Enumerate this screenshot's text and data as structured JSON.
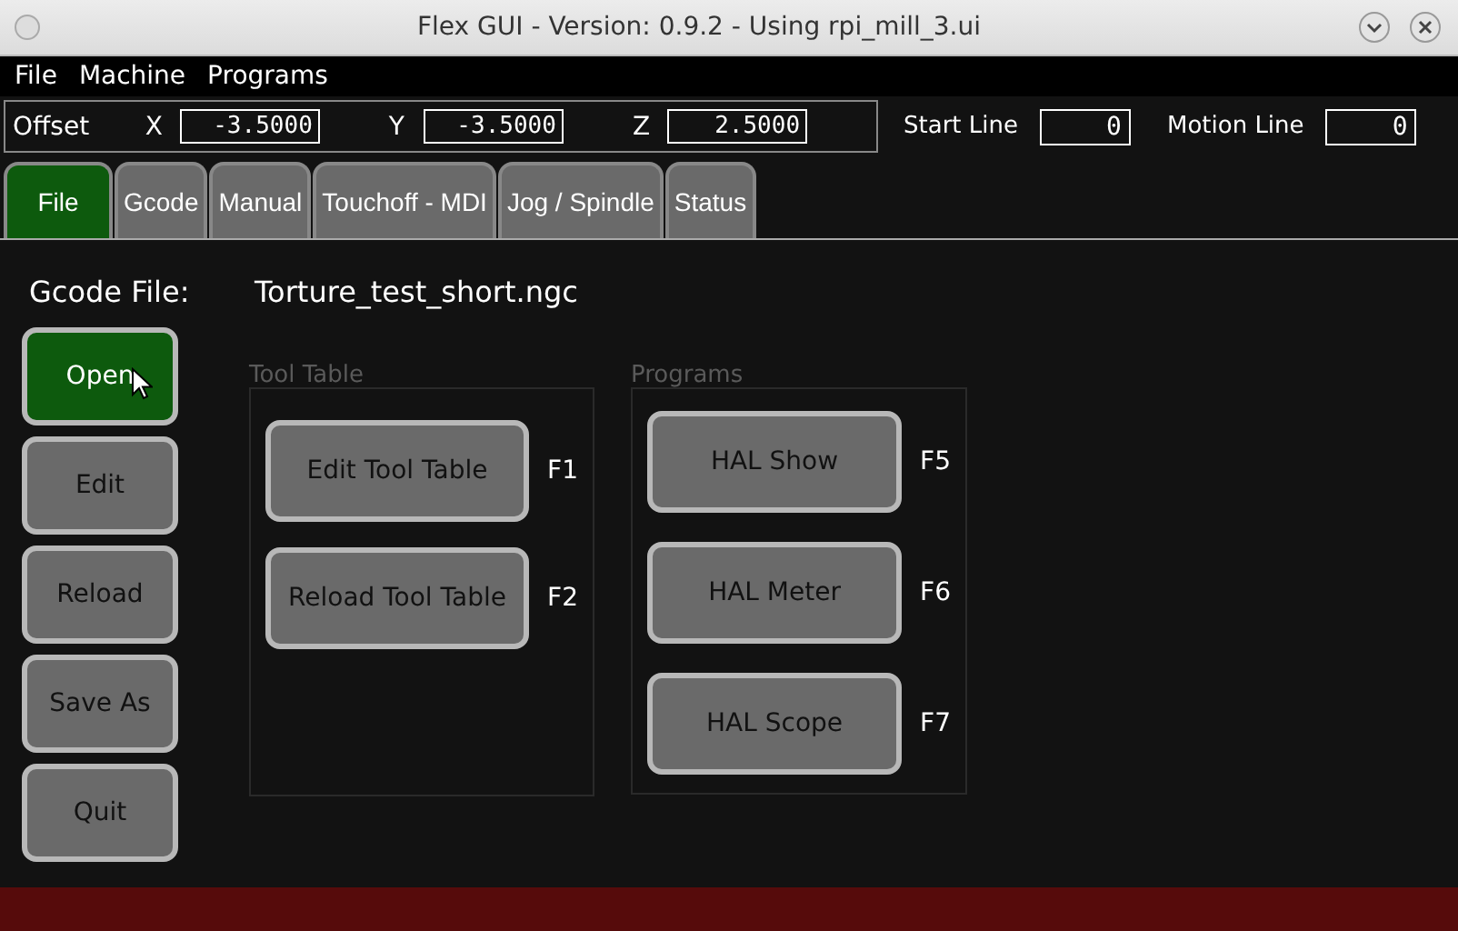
{
  "window": {
    "title": "Flex GUI - Version: 0.9.2 - Using rpi_mill_3.ui"
  },
  "menu": [
    "File",
    "Machine",
    "Programs"
  ],
  "offset": {
    "label": "Offset",
    "axes": [
      {
        "axis": "X",
        "value": "-3.5000"
      },
      {
        "axis": "Y",
        "value": "-3.5000"
      },
      {
        "axis": "Z",
        "value": "2.5000"
      }
    ]
  },
  "lines": [
    {
      "label": "Start Line",
      "value": "0"
    },
    {
      "label": "Motion Line",
      "value": "0"
    }
  ],
  "tabs": [
    {
      "label": "File",
      "selected": true
    },
    {
      "label": "Gcode",
      "selected": false
    },
    {
      "label": "Manual",
      "selected": false
    },
    {
      "label": "Touchoff - MDI",
      "selected": false
    },
    {
      "label": "Jog / Spindle",
      "selected": false
    },
    {
      "label": "Status",
      "selected": false
    }
  ],
  "gcode_file": {
    "label": "Gcode File:",
    "value": "Torture_test_short.ngc"
  },
  "file_buttons": [
    {
      "label": "Open",
      "highlighted": true
    },
    {
      "label": "Edit",
      "highlighted": false
    },
    {
      "label": "Reload",
      "highlighted": false
    },
    {
      "label": "Save As",
      "highlighted": false
    },
    {
      "label": "Quit",
      "highlighted": false
    }
  ],
  "groups": [
    {
      "title": "Tool Table",
      "buttons": [
        {
          "label": "Edit Tool Table",
          "key": "F1"
        },
        {
          "label": "Reload Tool Table",
          "key": "F2"
        }
      ]
    },
    {
      "title": "Programs",
      "buttons": [
        {
          "label": "HAL Show",
          "key": "F5"
        },
        {
          "label": "HAL Meter",
          "key": "F6"
        },
        {
          "label": "HAL Scope",
          "key": "F7"
        }
      ]
    }
  ]
}
